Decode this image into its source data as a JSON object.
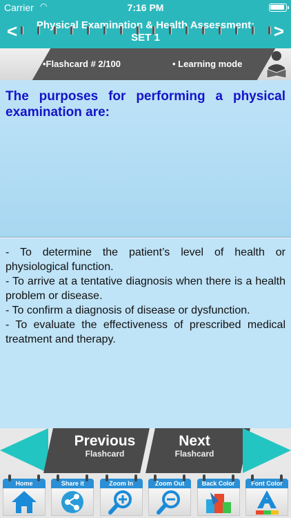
{
  "status_bar": {
    "carrier": "Carrier",
    "time": "7:16 PM"
  },
  "header": {
    "title_line1": "Physical Examination & Health Assessment:",
    "title_line2": "SET 1",
    "back": "<",
    "forward": ">"
  },
  "info_bar": {
    "flashcard_counter": "•Flashcard #  2/100",
    "mode": "• Learning mode"
  },
  "question": "The purposes for performing a physical examination are:",
  "answer": [
    "- To determine the patient’s level of health or physiological function.",
    "- To arrive at a tentative diagnosis when there is a health problem or disease.",
    "- To confirm a diagnosis of disease or dysfunction.",
    "- To evaluate the effectiveness of prescribed medical treatment and therapy."
  ],
  "flashcard_nav": {
    "previous": {
      "big": "Previous",
      "small": "Flashcard"
    },
    "next": {
      "big": "Next",
      "small": "Flashcard"
    }
  },
  "toolbar": [
    {
      "label": "Home",
      "icon": "home-icon"
    },
    {
      "label": "Share it",
      "icon": "share-icon"
    },
    {
      "label": "Zoom In",
      "icon": "zoom-in-icon"
    },
    {
      "label": "Zoom Out",
      "icon": "zoom-out-icon"
    },
    {
      "label": "Back Color",
      "icon": "paint-bucket-icon"
    },
    {
      "label": "Font Color",
      "icon": "font-color-icon"
    }
  ],
  "colors": {
    "teal": "#2bb8bd",
    "question_text": "#1414c8",
    "panel": "#bfe3f7"
  }
}
